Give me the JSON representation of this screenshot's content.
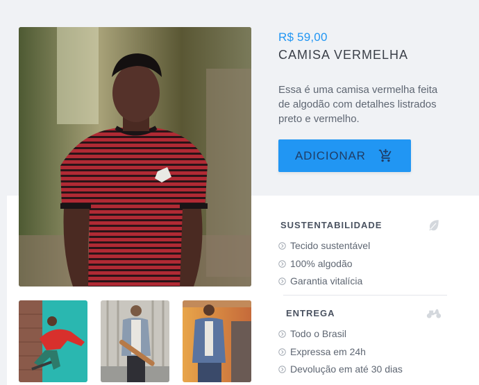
{
  "product": {
    "price": "R$ 59,00",
    "title": "CAMISA VERMELHA",
    "description": "Essa é uma camisa vermelha feita de algodão com detalhes listrados preto e vermelho.",
    "add_button_label": "ADICIONAR"
  },
  "sections": [
    {
      "title": "SUSTENTABILIDADE",
      "icon": "leaf-icon",
      "items": [
        "Tecido sustentável",
        "100% algodão",
        "Garantia vitalícia"
      ]
    },
    {
      "title": "ENTREGA",
      "icon": "scooter-icon",
      "items": [
        "Todo o Brasil",
        "Expressa em 24h",
        "Devolução em até 30 dias"
      ]
    }
  ],
  "colors": {
    "accent": "#2196f3",
    "background": "#f0f2f5",
    "icon_muted": "#d4d8dd"
  },
  "gallery": {
    "thumbnails": [
      "skater-red-hoodie",
      "man-denim-jacket-skateboard",
      "man-denim-jacket-sunset"
    ]
  }
}
